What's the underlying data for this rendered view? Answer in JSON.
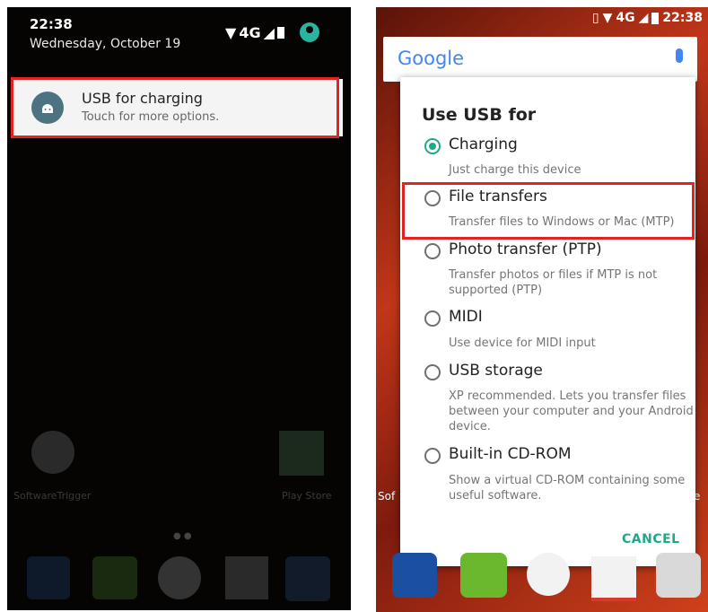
{
  "left_panel": {
    "status": {
      "time": "22:38",
      "date": "Wednesday, October 19",
      "network": "4G"
    },
    "notification": {
      "title": "USB for charging",
      "subtitle": "Touch for more options."
    },
    "home_apps": [
      {
        "label": "SoftwareTrigger"
      },
      {
        "label": "Play Store"
      }
    ]
  },
  "right_panel": {
    "status": {
      "time": "22:38",
      "network": "4G"
    },
    "google_bar": {
      "logo": "Google"
    },
    "dialog": {
      "title": "Use USB for",
      "options": [
        {
          "label": "Charging",
          "description": "Just charge this device",
          "selected": true
        },
        {
          "label": "File transfers",
          "description": "Transfer files to Windows or Mac (MTP)",
          "selected": false
        },
        {
          "label": "Photo transfer (PTP)",
          "description": "Transfer photos or files if MTP is not supported (PTP)",
          "selected": false
        },
        {
          "label": "MIDI",
          "description": "Use device for MIDI input",
          "selected": false
        },
        {
          "label": "USB storage",
          "description": "XP recommended. Lets you transfer files between your computer and your Android device.",
          "selected": false
        },
        {
          "label": "Built-in CD-ROM",
          "description": "Show a virtual CD-ROM containing some useful software.",
          "selected": false
        }
      ],
      "cancel_label": "CANCEL"
    },
    "partial_labels": {
      "left": "Sof",
      "right": "e"
    }
  },
  "colors": {
    "accent": "#1fa88a",
    "highlight": "#e32222",
    "notification_icon": "#4d7383"
  }
}
